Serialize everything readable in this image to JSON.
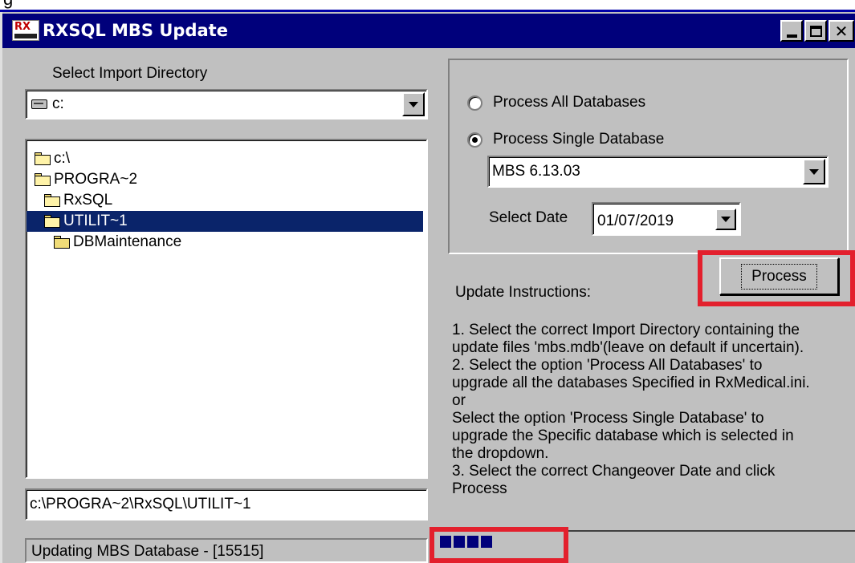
{
  "window": {
    "title": "RXSQL MBS Update",
    "icon": "rx-app-icon",
    "controls": [
      "minimize-icon",
      "maximize-icon",
      "close-icon"
    ]
  },
  "top_fragment": "g",
  "left_panel": {
    "import_label": "Select Import Directory",
    "drive": {
      "value": "c:",
      "icon": "drive-icon"
    },
    "folders": [
      {
        "label": "c:\\",
        "state": "open"
      },
      {
        "label": "PROGRA~2",
        "state": "open"
      },
      {
        "label": "RxSQL",
        "state": "open"
      },
      {
        "label": "UTILIT~1",
        "state": "open",
        "selected": true
      },
      {
        "label": "DBMaintenance",
        "state": "closed"
      }
    ],
    "path_value": "c:\\PROGRA~2\\RxSQL\\UTILIT~1",
    "status_text": "Updating MBS Database - [15515]"
  },
  "options": {
    "process_all_label": "Process All Databases",
    "process_single_label": "Process Single Database",
    "selected_option": "single",
    "database_value": "MBS 6.13.03",
    "select_date_label": "Select Date",
    "date_value": "01/07/2019"
  },
  "process_button": {
    "label": "Process"
  },
  "instructions": {
    "heading": "Update Instructions:",
    "lines": [
      "1. Select the correct Import Directory containing the",
      "update files 'mbs.mdb'(leave on default if uncertain).",
      "2. Select the option 'Process All Databases' to",
      "upgrade all the databases Specified in RxMedical.ini.",
      "or",
      "Select the option 'Process Single Database' to",
      "upgrade the Specific database which is selected in",
      "the dropdown.",
      "3. Select the correct Changeover Date and click",
      "Process"
    ]
  },
  "progress": {
    "segments": 4
  },
  "colors": {
    "title_bar": "#00007b",
    "selection": "#0a246a",
    "highlight_annotation": "#e3202d",
    "window_face": "#c0c0c0"
  }
}
